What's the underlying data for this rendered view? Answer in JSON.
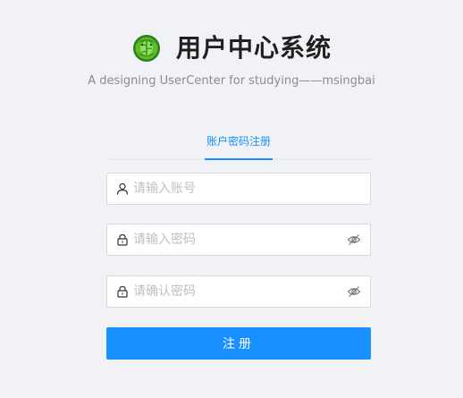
{
  "header": {
    "logo_icon": "cabbage-logo-icon",
    "title": "用户中心系统",
    "subtitle": "A designing UserCenter for studying——msingbai"
  },
  "tabs": [
    {
      "label": "账户密码注册",
      "active": true
    }
  ],
  "form": {
    "account": {
      "placeholder": "请输入账号",
      "value": "",
      "icon": "user-icon"
    },
    "password": {
      "placeholder": "请输入密码",
      "value": "",
      "icon": "lock-icon",
      "toggle_icon": "eye-invisible-icon"
    },
    "confirm": {
      "placeholder": "请确认密码",
      "value": "",
      "icon": "lock-icon",
      "toggle_icon": "eye-invisible-icon"
    },
    "submit_label": "注册"
  },
  "colors": {
    "primary": "#1890ff",
    "background": "#f0f2f5",
    "logo_green": "#52c41a"
  }
}
